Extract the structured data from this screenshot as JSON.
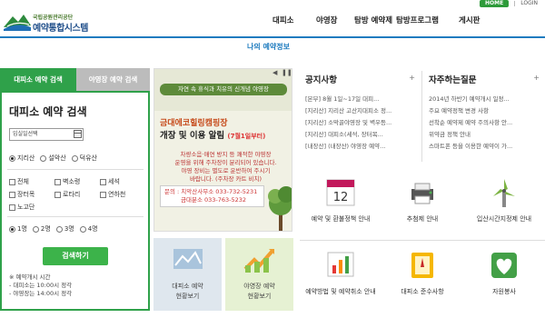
{
  "top": {
    "home_label": "HOME",
    "login_label": "LOGIN"
  },
  "logo": {
    "org": "국립공원관리공단",
    "name": "예약통합시스템"
  },
  "nav": {
    "items": [
      "대피소",
      "야영장",
      "탐방 예약제",
      "탐방프로그램",
      "게시판"
    ]
  },
  "page_title": "나의 예약정보",
  "reservation": {
    "tabs": [
      "대피소 예약 검색",
      "야영장 예약 검색"
    ],
    "title": "대피소 예약 검색",
    "date_placeholder": "입실일선택",
    "parks": [
      "지리산",
      "설악산",
      "덕유산"
    ],
    "shelters": [
      "전체",
      "벽소령",
      "세석",
      "장터목",
      "로타리",
      "연하천",
      "노고단"
    ],
    "people": [
      "1명",
      "2명",
      "3명",
      "4명"
    ],
    "search_label": "검색하기",
    "notes": [
      "※ 예약개시 시간",
      "- 대피소는 10:00시 정각",
      "- 야영장는 14:00시 정각"
    ]
  },
  "banner": {
    "tagline": "자연 속 휴식과 치유의 신개념 야영장",
    "title1": "금대에코힐링캠핑장",
    "title2": "개장 및 이용 알림",
    "date": "(7월1일부터)",
    "body": [
      "차량소음·매연 방지 등 쾌적한 야영장",
      "운영을 위해 주차장이 분리되어 있습니다.",
      "야영 장비는 별도로 운반하여 주시기",
      "바랍니다. (주차장 카트 비치)"
    ],
    "contact_label": "문의 :",
    "contact1": "치악산사무소 033-732-5231",
    "contact2": "금대분소 033-763-5232"
  },
  "quick": [
    {
      "line1": "대피소 예약",
      "line2": "현황보기"
    },
    {
      "line1": "야영장 예약",
      "line2": "현황보기"
    }
  ],
  "notice": {
    "title": "공지사항",
    "plus": "+",
    "items": [
      "[본부] 8월 1일~17일 대피...",
      "[지리산] 지리산 고산지대피소 정...",
      "[지리산] 소막골야영장 및 벽우등...",
      "[지리산] 대피소(세석, 장터목...",
      "[내장산] (내장산) 야영장 예약..."
    ]
  },
  "faq": {
    "title": "자주하는질문",
    "plus": "+",
    "items": [
      "2014년 하반기 예약개시 일정...",
      "주요 예약정책 변경 사항",
      "선착순 예약제 예약 주의사항 안...",
      "위약금 정책 안내",
      "스마트폰 등을 이용한 예약이 가..."
    ]
  },
  "icons": [
    {
      "name": "calendar-icon",
      "label": "예약 및 환불정책 안내",
      "num": "12"
    },
    {
      "name": "printer-icon",
      "label": "추첨제 안내"
    },
    {
      "name": "windmill-icon",
      "label": "입산시간지정제 안내"
    },
    {
      "name": "chart-icon",
      "label": "예약방법 및 예약취소 안내"
    },
    {
      "name": "book-icon",
      "label": "대피소 준수사항"
    },
    {
      "name": "heart-icon",
      "label": "자원봉사"
    }
  ]
}
